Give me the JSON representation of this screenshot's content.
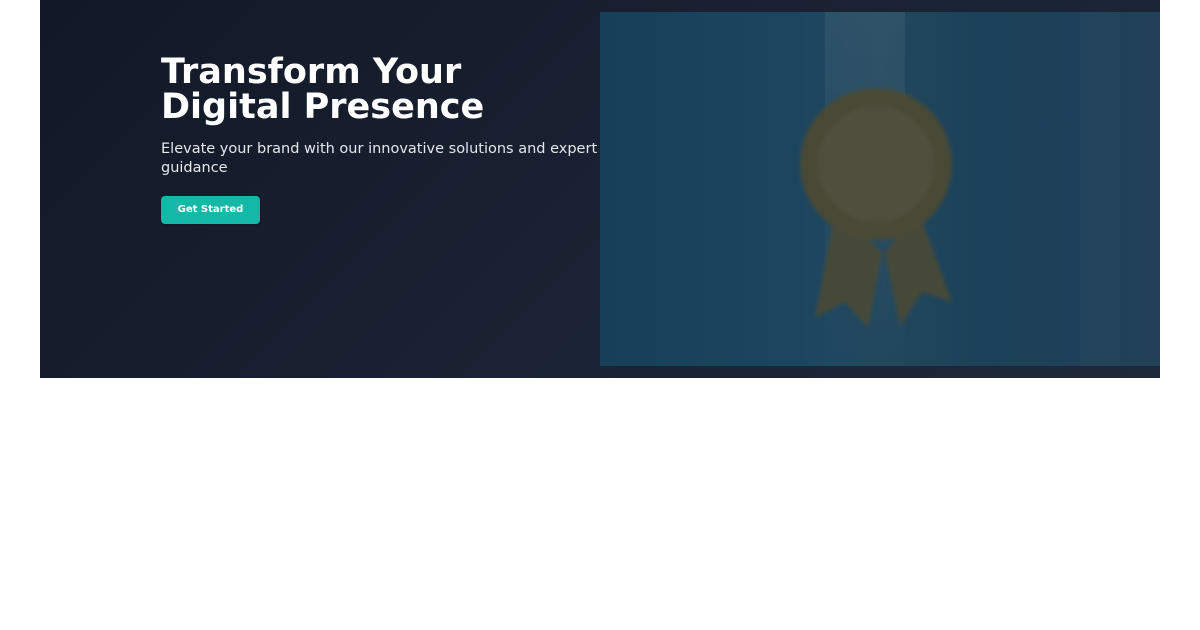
{
  "hero": {
    "title": "Transform Your Digital Presence",
    "subtitle": "Elevate your brand with our innovative solutions and expert guidance",
    "cta_label": "Get Started",
    "image_icon": "award-ribbon-icon"
  },
  "colors": {
    "hero_background": "#111827",
    "accent": "#14b8a6",
    "image_tint": "#1a4258",
    "badge": "#4a4a3c"
  }
}
